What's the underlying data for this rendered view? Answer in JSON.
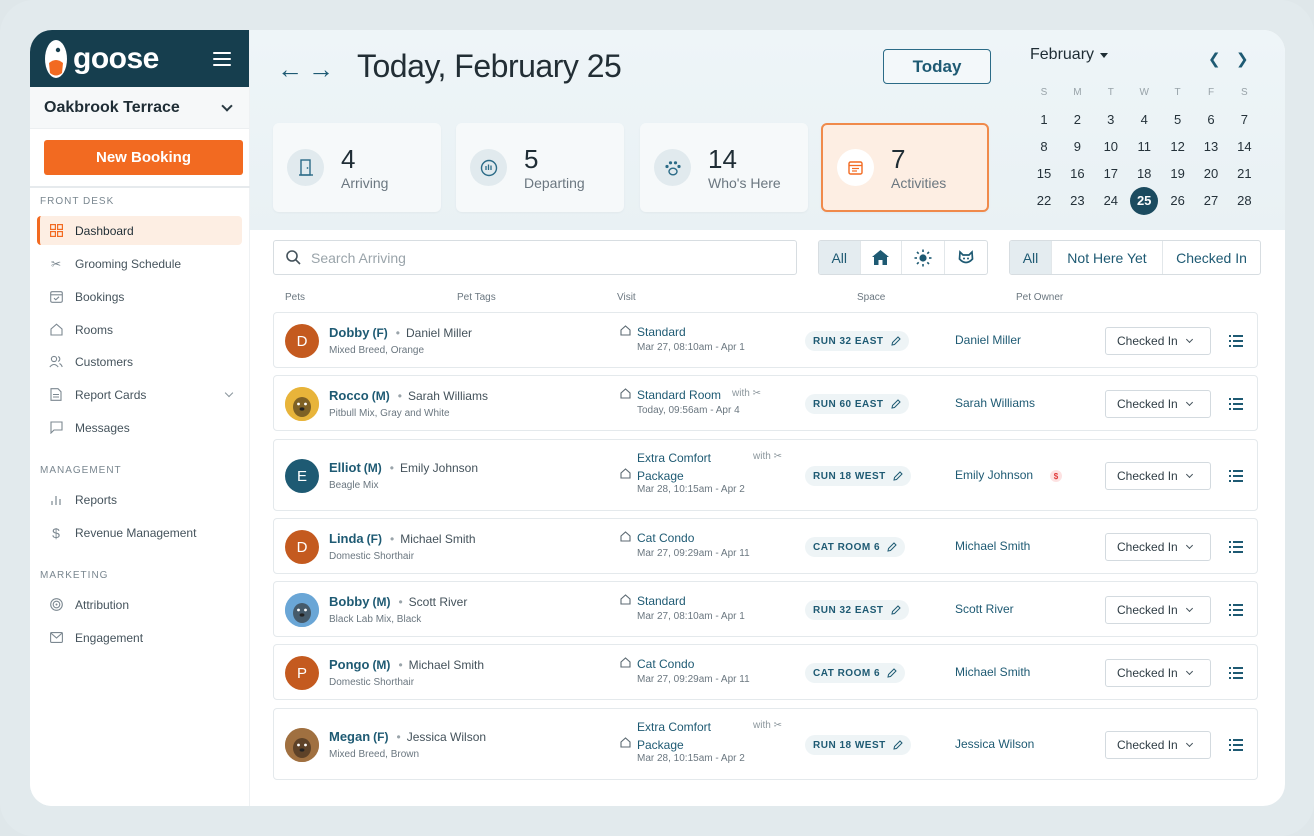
{
  "brand": {
    "name": "goose"
  },
  "location": "Oakbrook Terrace",
  "new_booking": "New Booking",
  "sections": {
    "front_desk": "FRONT DESK",
    "management": "MANAGEMENT",
    "marketing": "MARKETING"
  },
  "nav": {
    "dashboard": "Dashboard",
    "grooming": "Grooming Schedule",
    "bookings": "Bookings",
    "rooms": "Rooms",
    "customers": "Customers",
    "report_cards": "Report Cards",
    "messages": "Messages",
    "reports": "Reports",
    "revenue": "Revenue Management",
    "attribution": "Attribution",
    "engagement": "Engagement"
  },
  "header": {
    "title": "Today, February 25",
    "today_button": "Today"
  },
  "stats": [
    {
      "value": "4",
      "label": "Arriving",
      "icon": "door-icon"
    },
    {
      "value": "5",
      "label": "Departing",
      "icon": "wave-icon"
    },
    {
      "value": "14",
      "label": "Who's Here",
      "icon": "paw-icon"
    },
    {
      "value": "7",
      "label": "Activities",
      "icon": "calendar-icon"
    }
  ],
  "calendar": {
    "month": "February",
    "dow": [
      "S",
      "M",
      "T",
      "W",
      "T",
      "F",
      "S"
    ],
    "weeks": [
      [
        "1",
        "2",
        "3",
        "4",
        "5",
        "6",
        "7"
      ],
      [
        "8",
        "9",
        "10",
        "11",
        "12",
        "13",
        "14"
      ],
      [
        "15",
        "16",
        "17",
        "18",
        "19",
        "20",
        "21"
      ],
      [
        "22",
        "23",
        "24",
        "25",
        "26",
        "27",
        "28"
      ]
    ],
    "selected": "25"
  },
  "search": {
    "placeholder": "Search Arriving"
  },
  "filter_type": {
    "all": "All"
  },
  "filter_status": {
    "all": "All",
    "not_here": "Not Here Yet",
    "checked_in": "Checked In"
  },
  "columns": {
    "pets": "Pets",
    "tags": "Pet Tags",
    "visit": "Visit",
    "space": "Space",
    "owner": "Pet Owner"
  },
  "rows": [
    {
      "pet": "Dobby",
      "sex": "(F)",
      "owner": "Daniel Miller",
      "breed": "Mixed Breed, Orange",
      "visit": "Standard",
      "visit2": "",
      "with": "",
      "dates": "Mar 27, 08:10am - Apr 1",
      "space": "RUN 32 EAST",
      "status": "Checked In",
      "initial": "D",
      "avatar_color": "#c45a1f",
      "dollar": ""
    },
    {
      "pet": "Rocco",
      "sex": "(M)",
      "owner": "Sarah Williams",
      "breed": "Pitbull Mix, Gray and White",
      "visit": "Standard Room",
      "visit2": "",
      "with": "with",
      "dates": "Today, 09:56am - Apr 4",
      "space": "RUN 60 EAST",
      "status": "Checked In",
      "initial": "",
      "avatar_color": "#e8b43a",
      "dollar": ""
    },
    {
      "pet": "Elliot",
      "sex": "(M)",
      "owner": "Emily Johnson",
      "breed": "Beagle Mix",
      "visit": "Extra Comfort",
      "visit2": "Package",
      "with": "with",
      "dates": "Mar 28, 10:15am - Apr 2",
      "space": "RUN 18 WEST",
      "status": "Checked In",
      "initial": "E",
      "avatar_color": "#1e5a73",
      "dollar": "$"
    },
    {
      "pet": "Linda",
      "sex": "(F)",
      "owner": "Michael Smith",
      "breed": "Domestic Shorthair",
      "visit": "Cat Condo",
      "visit2": "",
      "with": "",
      "dates": "Mar 27, 09:29am - Apr 11",
      "space": "CAT ROOM 6",
      "status": "Checked In",
      "initial": "D",
      "avatar_color": "#c45a1f",
      "dollar": ""
    },
    {
      "pet": "Bobby",
      "sex": "(M)",
      "owner": "Scott River",
      "breed": "Black Lab Mix, Black",
      "visit": "Standard",
      "visit2": "",
      "with": "",
      "dates": "Mar 27, 08:10am - Apr 1",
      "space": "RUN 32 EAST",
      "status": "Checked In",
      "initial": "",
      "avatar_color": "#6aa6d6",
      "dollar": ""
    },
    {
      "pet": "Pongo",
      "sex": "(M)",
      "owner": "Michael Smith",
      "breed": "Domestic Shorthair",
      "visit": "Cat Condo",
      "visit2": "",
      "with": "",
      "dates": "Mar 27, 09:29am - Apr 11",
      "space": "CAT ROOM 6",
      "status": "Checked In",
      "initial": "P",
      "avatar_color": "#c45a1f",
      "dollar": ""
    },
    {
      "pet": "Megan",
      "sex": "(F)",
      "owner": "Jessica Wilson",
      "breed": "Mixed Breed, Brown",
      "visit": "Extra Comfort",
      "visit2": "Package",
      "with": "with",
      "dates": "Mar 28, 10:15am - Apr 2",
      "space": "RUN 18 WEST",
      "status": "Checked In",
      "initial": "",
      "avatar_color": "#a07040",
      "dollar": ""
    }
  ]
}
